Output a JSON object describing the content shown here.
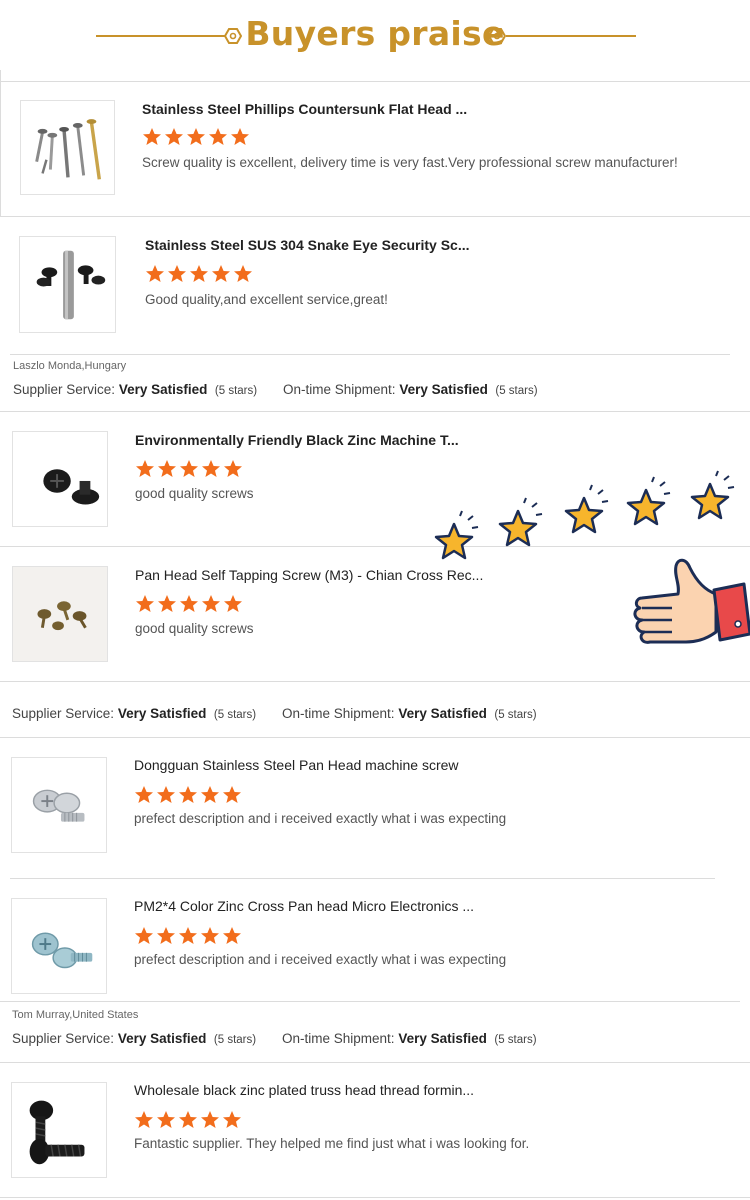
{
  "header": {
    "title": "Buyers praise"
  },
  "colors": {
    "gold": "#c8922a",
    "star_orange": "#f26d1c",
    "deco_star": "#f7b52c"
  },
  "reviews": [
    {
      "title": "Stainless Steel Phillips Countersunk Flat Head ...",
      "comment": "Screw quality is excellent, delivery time is very fast.Very professional screw manufacturer!",
      "stars": 5,
      "image": "screw-assortment-image"
    },
    {
      "title": "Stainless Steel SUS 304 Snake Eye Security Sc...",
      "comment": "Good quality,and excellent service,great!",
      "stars": 5,
      "image": "security-screw-bit-image"
    },
    {
      "title": "Environmentally Friendly Black Zinc Machine T...",
      "comment": "good quality screws",
      "stars": 5,
      "image": "black-machine-screw-image"
    },
    {
      "title": "Pan Head Self Tapping Screw (M3) - Chian Cross Rec...",
      "comment": "good quality screws",
      "stars": 5,
      "image": "bronze-tapping-screw-image"
    },
    {
      "title": "Dongguan Stainless Steel Pan Head machine screw",
      "comment": "prefect description and i received exactly what i was expecting",
      "stars": 5,
      "image": "stainless-pan-head-image"
    },
    {
      "title": "PM2*4 Color Zinc Cross Pan head Micro Electronics ...",
      "comment": "prefect description and i received exactly what i was expecting",
      "stars": 5,
      "image": "blue-zinc-screw-image"
    },
    {
      "title": "Wholesale black zinc plated truss head thread formin...",
      "comment": "Fantastic supplier. They helped me find just what i was looking for.",
      "stars": 5,
      "image": "black-truss-screw-image"
    }
  ],
  "reviewers": [
    {
      "name": "Laszlo Monda,Hungary"
    },
    {
      "name": ""
    },
    {
      "name": "Tom Murray,United States"
    }
  ],
  "ratings": {
    "supplier_label": "Supplier Service:",
    "shipment_label": "On-time Shipment:",
    "value": "Very Satisfied",
    "count": "(5 stars)"
  }
}
